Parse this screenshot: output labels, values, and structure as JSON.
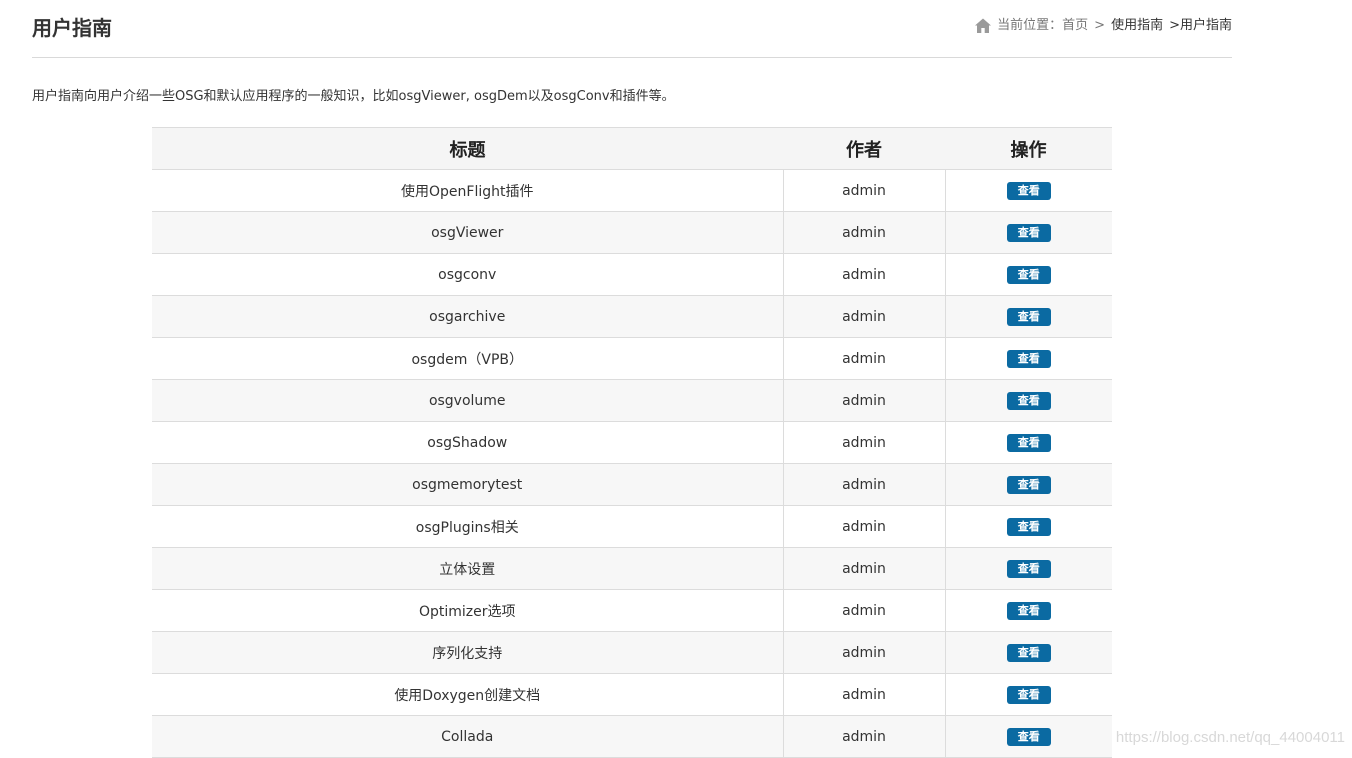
{
  "header": {
    "title": "用户指南",
    "breadcrumb": {
      "prefix": "当前位置：",
      "home": "首页",
      "sep1": ">",
      "parent": "使用指南",
      "sep2": ">",
      "current": "用户指南"
    }
  },
  "intro": "用户指南向用户介绍一些OSG和默认应用程序的一般知识，比如osgViewer, osgDem以及osgConv和插件等。",
  "table": {
    "columns": [
      "标题",
      "作者",
      "操作"
    ],
    "rows": [
      {
        "title": "使用OpenFlight插件",
        "author": "admin",
        "action": "查看"
      },
      {
        "title": "osgViewer",
        "author": "admin",
        "action": "查看"
      },
      {
        "title": "osgconv",
        "author": "admin",
        "action": "查看"
      },
      {
        "title": "osgarchive",
        "author": "admin",
        "action": "查看"
      },
      {
        "title": "osgdem（VPB）",
        "author": "admin",
        "action": "查看"
      },
      {
        "title": "osgvolume",
        "author": "admin",
        "action": "查看"
      },
      {
        "title": "osgShadow",
        "author": "admin",
        "action": "查看"
      },
      {
        "title": "osgmemorytest",
        "author": "admin",
        "action": "查看"
      },
      {
        "title": "osgPlugins相关",
        "author": "admin",
        "action": "查看"
      },
      {
        "title": "立体设置",
        "author": "admin",
        "action": "查看"
      },
      {
        "title": "Optimizer选项",
        "author": "admin",
        "action": "查看"
      },
      {
        "title": "序列化支持",
        "author": "admin",
        "action": "查看"
      },
      {
        "title": "使用Doxygen创建文档",
        "author": "admin",
        "action": "查看"
      },
      {
        "title": "Collada",
        "author": "admin",
        "action": "查看"
      }
    ]
  },
  "watermark": "https://blog.csdn.net/qq_44004011",
  "colors": {
    "accent": "#0b6aa2",
    "row_alt": "#f7f7f7",
    "border": "#dcdcdc"
  },
  "icons": {
    "home": "home-icon"
  }
}
